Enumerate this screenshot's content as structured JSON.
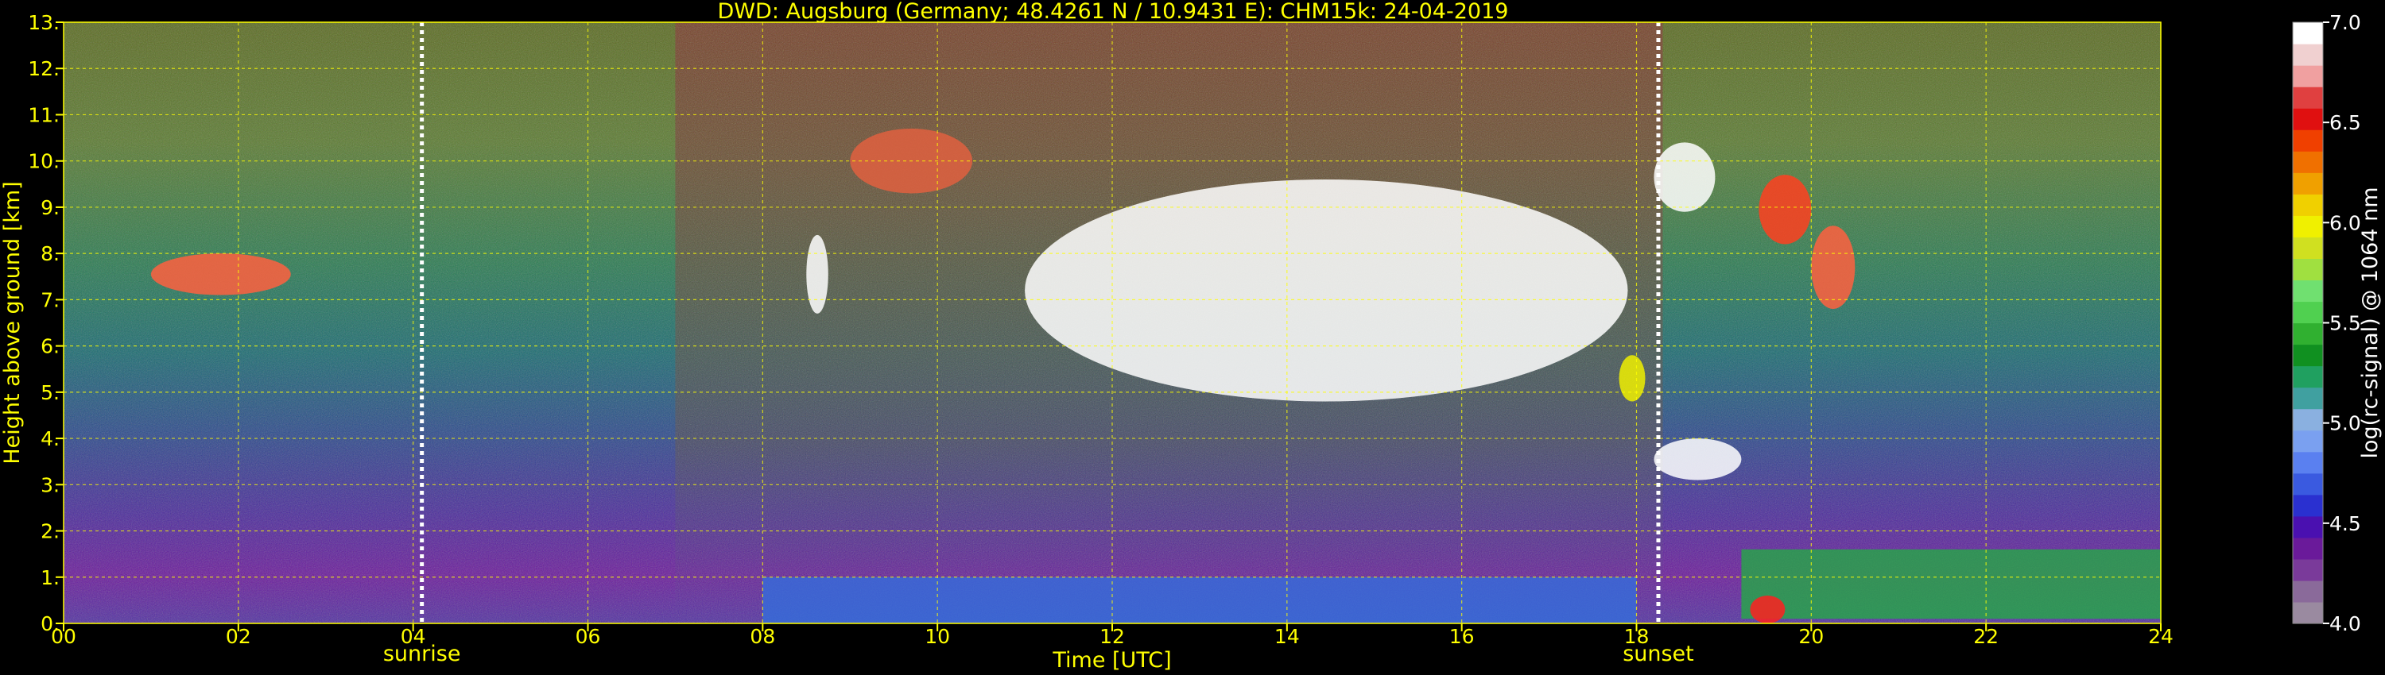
{
  "chart_data": {
    "type": "heatmap",
    "title": "DWD: Augsburg (Germany; 48.4261 N / 10.9431 E):    CHM15k: 24-04-2019",
    "xlabel": "Time [UTC]",
    "ylabel": "Height above ground [km]",
    "colorbar_label": "log(rc-signal) @ 1064 nm",
    "xlim": [
      0,
      24
    ],
    "ylim": [
      0,
      13
    ],
    "x_ticks": [
      "00",
      "02",
      "04",
      "06",
      "08",
      "10",
      "12",
      "14",
      "16",
      "18",
      "20",
      "22",
      "24"
    ],
    "y_ticks": [
      "0.",
      "1.",
      "2.",
      "3.",
      "4.",
      "5.",
      "6.",
      "7.",
      "8.",
      "9.",
      "10.",
      "11.",
      "12.",
      "13."
    ],
    "colorbar_range": [
      4.0,
      7.0
    ],
    "colorbar_ticks": [
      "4.0",
      "4.5",
      "5.0",
      "5.5",
      "6.0",
      "6.5",
      "7.0"
    ],
    "colorbar_colors": [
      "#9a8aa0",
      "#8a6a9a",
      "#7a3a9a",
      "#6a1a9a",
      "#4a10b0",
      "#2a30d0",
      "#3a5ae0",
      "#5a80f0",
      "#7aa0f0",
      "#8ab0e0",
      "#40a0a0",
      "#20a060",
      "#109020",
      "#30b030",
      "#50d050",
      "#70e070",
      "#a0e040",
      "#d0e020",
      "#f0f000",
      "#f0d000",
      "#f0a000",
      "#f07000",
      "#f04000",
      "#e01010",
      "#e04040",
      "#f0a0a0",
      "#f0d0d0",
      "#ffffff"
    ],
    "events": [
      {
        "label": "sunrise",
        "time": 4.1
      },
      {
        "label": "sunset",
        "time": 18.25
      }
    ],
    "grid": true,
    "features": [
      {
        "kind": "cloud",
        "t0": 1.0,
        "t1": 2.6,
        "h0": 7.1,
        "h1": 8.0,
        "color": "#ff6040"
      },
      {
        "kind": "cloud",
        "t0": 9.0,
        "t1": 10.4,
        "h0": 9.3,
        "h1": 10.7,
        "color": "#e06040"
      },
      {
        "kind": "cloud",
        "t0": 8.5,
        "t1": 8.75,
        "h0": 6.7,
        "h1": 8.4,
        "color": "#ffffff"
      },
      {
        "kind": "cloud",
        "t0": 11.0,
        "t1": 17.9,
        "h0": 4.8,
        "h1": 9.6,
        "color": "#ffffff"
      },
      {
        "kind": "cloud",
        "t0": 17.8,
        "t1": 18.1,
        "h0": 4.8,
        "h1": 5.8,
        "color": "#f0f000"
      },
      {
        "kind": "cloud",
        "t0": 18.2,
        "t1": 18.9,
        "h0": 8.9,
        "h1": 10.4,
        "color": "#ffffff"
      },
      {
        "kind": "cloud",
        "t0": 19.4,
        "t1": 20.0,
        "h0": 8.2,
        "h1": 9.7,
        "color": "#ff4020"
      },
      {
        "kind": "cloud",
        "t0": 20.0,
        "t1": 20.5,
        "h0": 6.8,
        "h1": 8.6,
        "color": "#ff6040"
      },
      {
        "kind": "cloud",
        "t0": 18.2,
        "t1": 19.2,
        "h0": 3.1,
        "h1": 4.0,
        "color": "#ffffff"
      },
      {
        "kind": "layer",
        "t0": 19.2,
        "t1": 24.0,
        "h0": 0.1,
        "h1": 1.6,
        "color": "#20b040"
      },
      {
        "kind": "layer",
        "t0": 8.0,
        "t1": 18.0,
        "h0": 0.0,
        "h1": 1.0,
        "color": "#3070e0"
      },
      {
        "kind": "cloud",
        "t0": 19.3,
        "t1": 19.7,
        "h0": 0.0,
        "h1": 0.6,
        "color": "#ff2020"
      }
    ]
  }
}
